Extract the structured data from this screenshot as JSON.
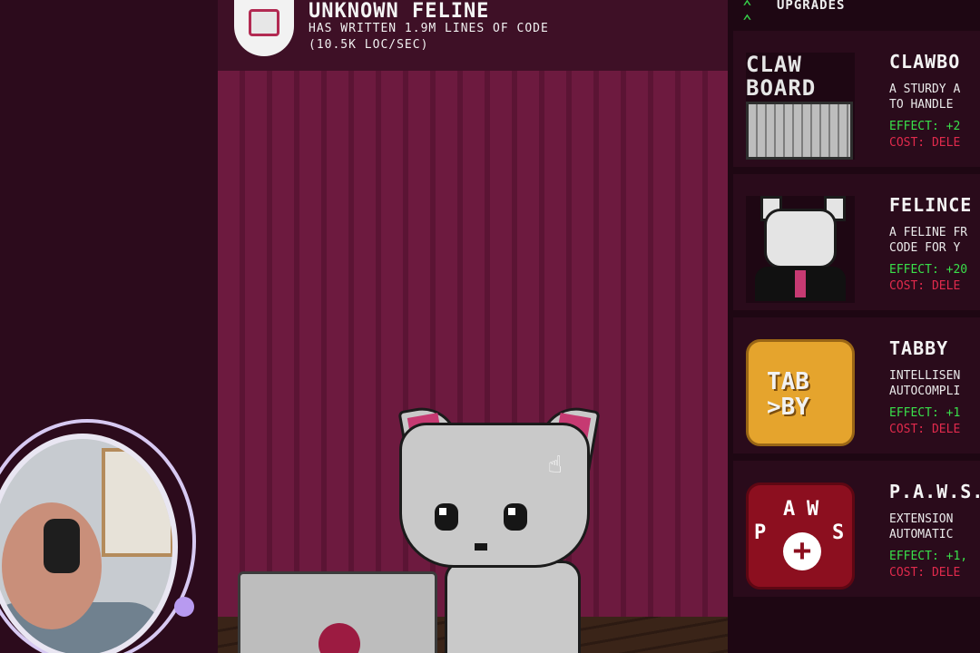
{
  "header": {
    "title": "UNKNOWN FELINE",
    "stat_line_1": "HAS WRITTEN 1.9M LINES OF CODE",
    "stat_line_2": "(10.5K LOC/SEC)"
  },
  "upgrades": {
    "title": "UPGRADES",
    "items": [
      {
        "name": "CLAWBO",
        "image_text": "CLAW\nBOARD",
        "desc": "A STURDY A\nTO HANDLE ",
        "effect": "EFFECT: +2",
        "cost": "COST: DELE"
      },
      {
        "name": "FELINCE",
        "desc": "A FELINE FR\nCODE FOR Y",
        "effect": "EFFECT: +20",
        "cost": "COST: DELE"
      },
      {
        "name": "TABBY",
        "image_text": "TAB\n>BY",
        "desc": "INTELLISEN\nAUTOCOMPLI",
        "effect": "EFFECT: +1",
        "cost": "COST: DELE"
      },
      {
        "name": "P.A.W.S.",
        "desc": "EXTENSION\nAUTOMATIC",
        "effect": "EFFECT: +1,",
        "cost": "COST: DELE",
        "image_letters": [
          "P",
          "A",
          "W",
          "S"
        ]
      }
    ]
  },
  "colors": {
    "effect": "#39e04a",
    "cost": "#e02a4c",
    "stage": "#6d1a3f",
    "panel": "#1e0713"
  }
}
